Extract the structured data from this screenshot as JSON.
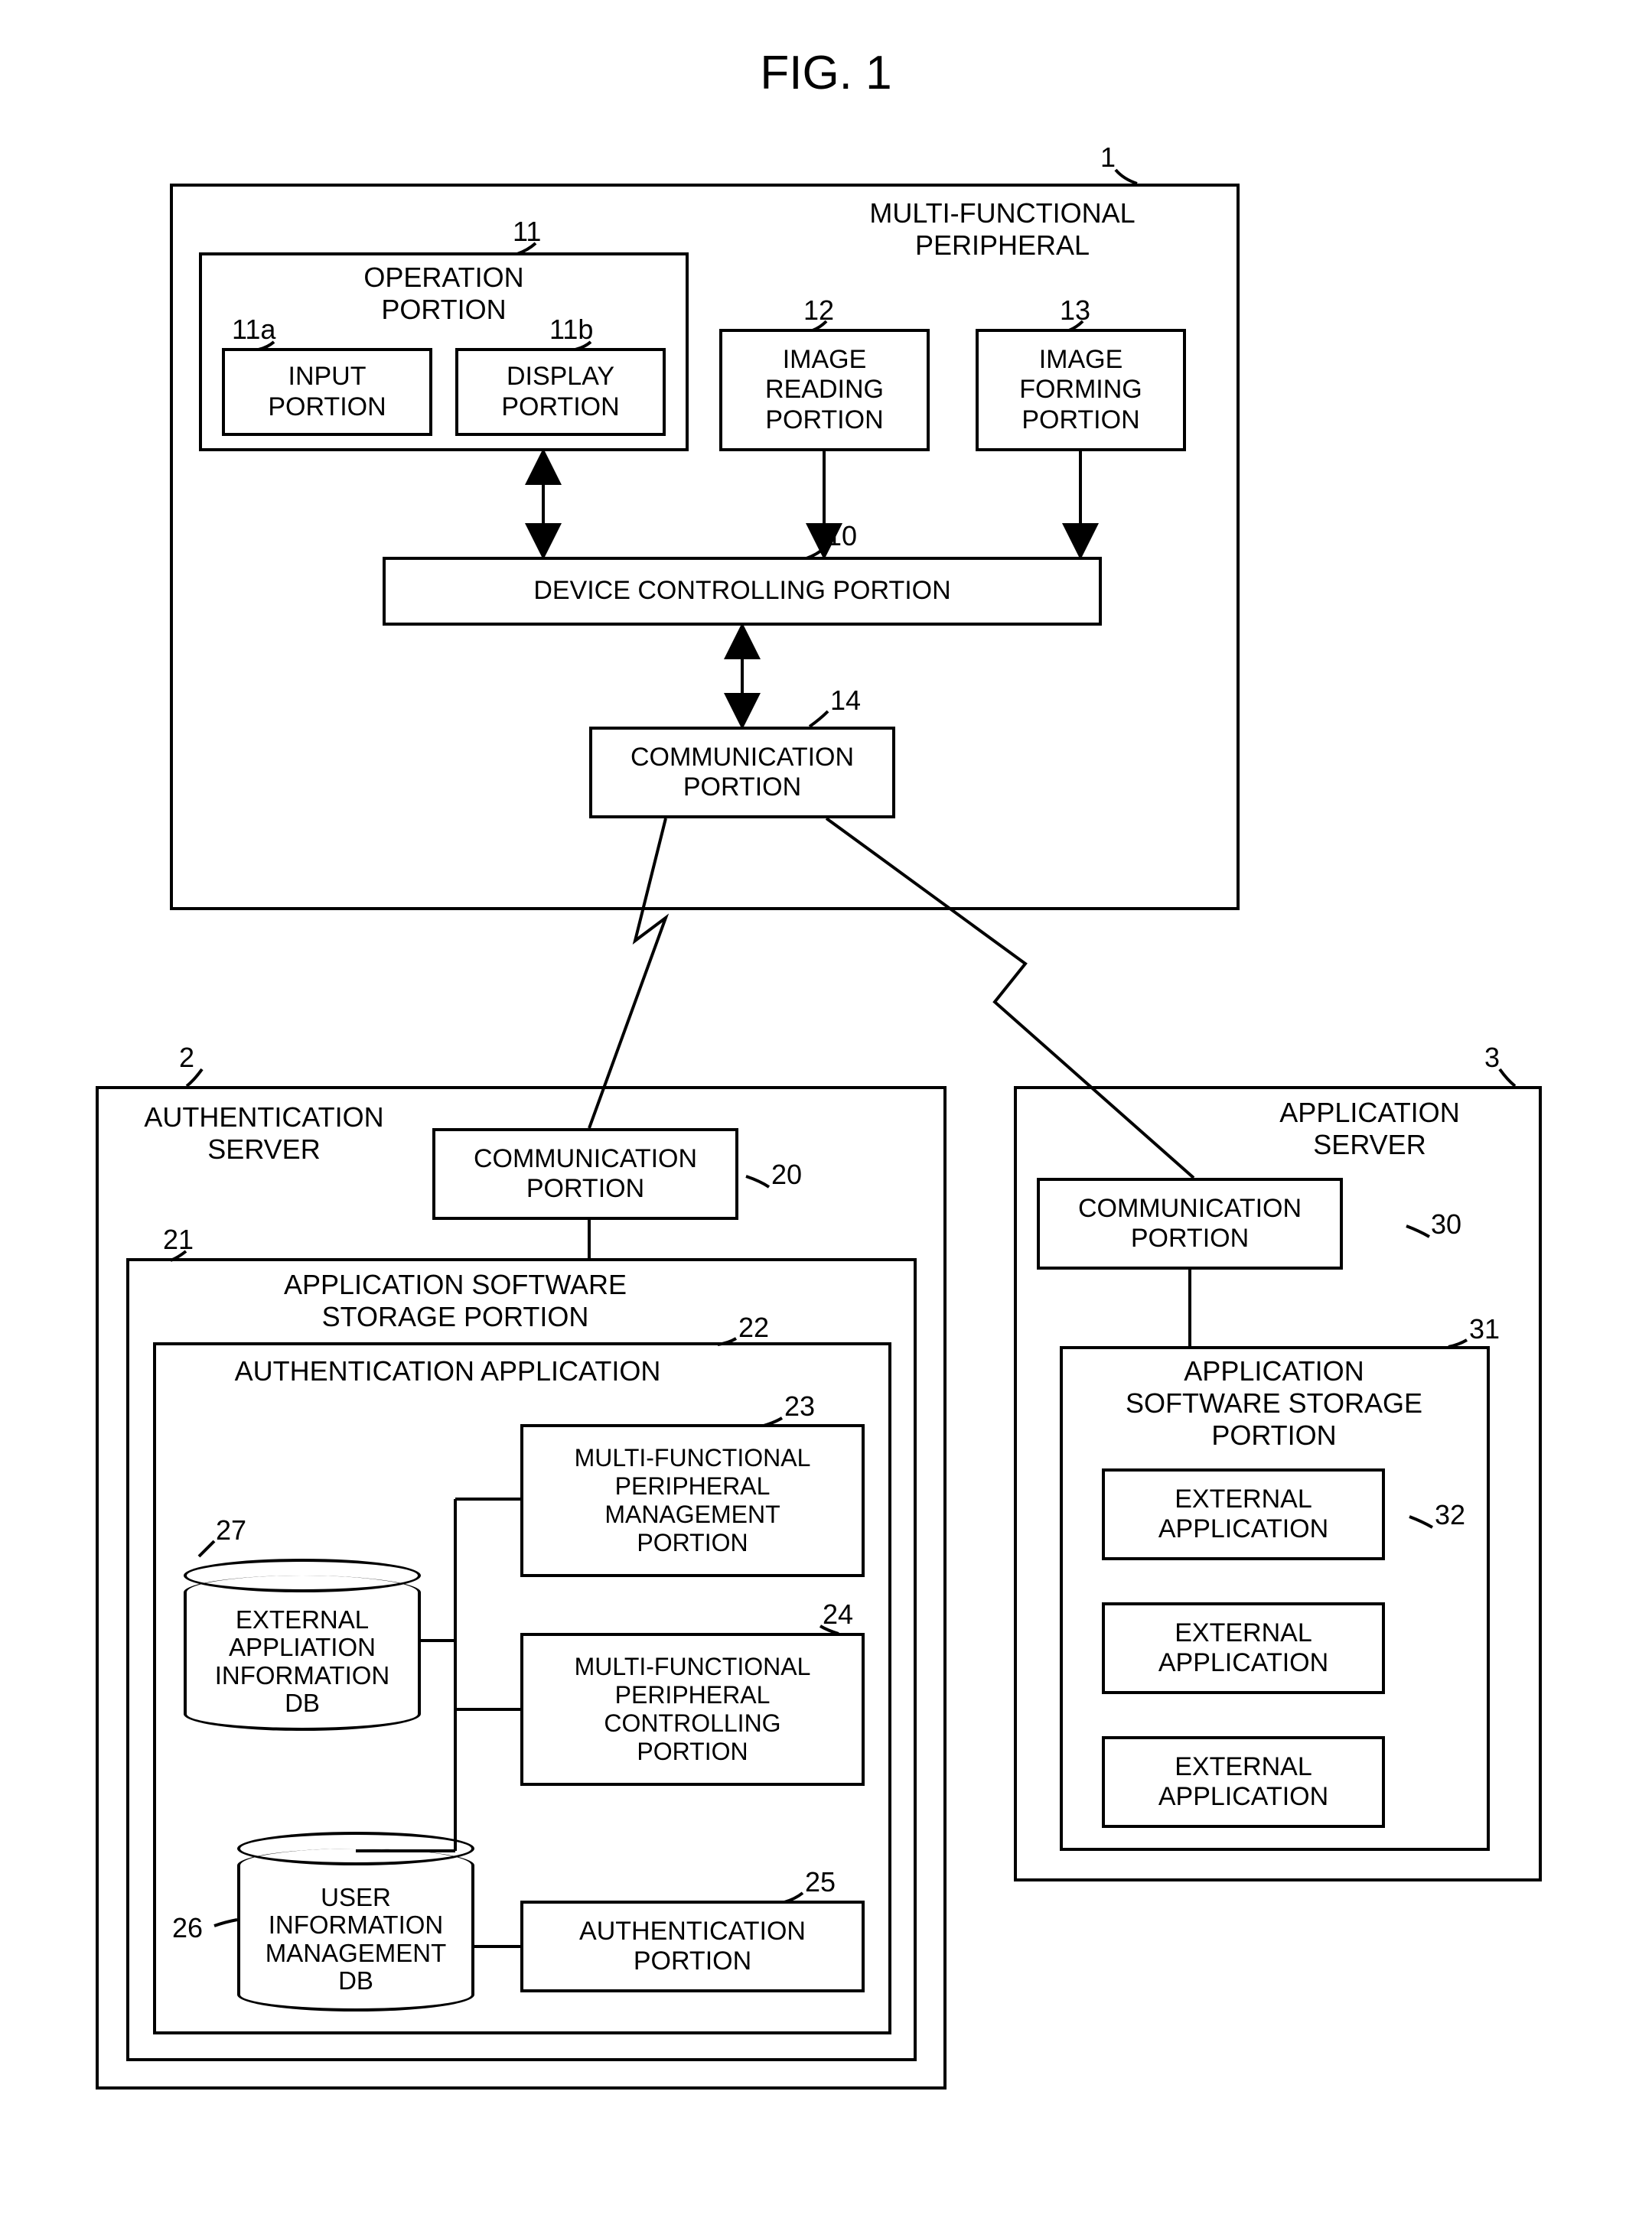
{
  "figure_title": "FIG. 1",
  "mfp": {
    "ref": "1",
    "title": "MULTI-FUNCTIONAL\nPERIPHERAL",
    "operation": {
      "ref": "11",
      "title": "OPERATION\nPORTION",
      "input": {
        "ref": "11a",
        "label": "INPUT\nPORTION"
      },
      "display": {
        "ref": "11b",
        "label": "DISPLAY\nPORTION"
      }
    },
    "reading": {
      "ref": "12",
      "label": "IMAGE\nREADING\nPORTION"
    },
    "forming": {
      "ref": "13",
      "label": "IMAGE\nFORMING\nPORTION"
    },
    "control": {
      "ref": "10",
      "label": "DEVICE CONTROLLING PORTION"
    },
    "comm": {
      "ref": "14",
      "label": "COMMUNICATION\nPORTION"
    }
  },
  "auth": {
    "ref": "2",
    "title": "AUTHENTICATION\nSERVER",
    "comm": {
      "ref": "20",
      "label": "COMMUNICATION\nPORTION"
    },
    "store": {
      "ref": "21",
      "title": "APPLICATION SOFTWARE\nSTORAGE PORTION",
      "authapp": {
        "ref": "22",
        "title": "AUTHENTICATION APPLICATION",
        "mfp_mgmt": {
          "ref": "23",
          "label": "MULTI-FUNCTIONAL\nPERIPHERAL\nMANAGEMENT\nPORTION"
        },
        "mfp_ctrl": {
          "ref": "24",
          "label": "MULTI-FUNCTIONAL\nPERIPHERAL\nCONTROLLING\nPORTION"
        },
        "auth_p": {
          "ref": "25",
          "label": "AUTHENTICATION\nPORTION"
        },
        "user_db": {
          "ref": "26",
          "label": "USER\nINFORMATION\nMANAGEMENT\nDB"
        },
        "ext_db": {
          "ref": "27",
          "label": "EXTERNAL\nAPPLIATION\nINFORMATION\nDB"
        }
      }
    }
  },
  "app": {
    "ref": "3",
    "title": "APPLICATION\nSERVER",
    "comm": {
      "ref": "30",
      "label": "COMMUNICATION\nPORTION"
    },
    "store": {
      "ref": "31",
      "title": "APPLICATION\nSOFTWARE STORAGE\nPORTION",
      "ext1": {
        "ref": "32",
        "label": "EXTERNAL\nAPPLICATION"
      },
      "ext2": {
        "label": "EXTERNAL\nAPPLICATION"
      },
      "ext3": {
        "label": "EXTERNAL\nAPPLICATION"
      }
    }
  }
}
